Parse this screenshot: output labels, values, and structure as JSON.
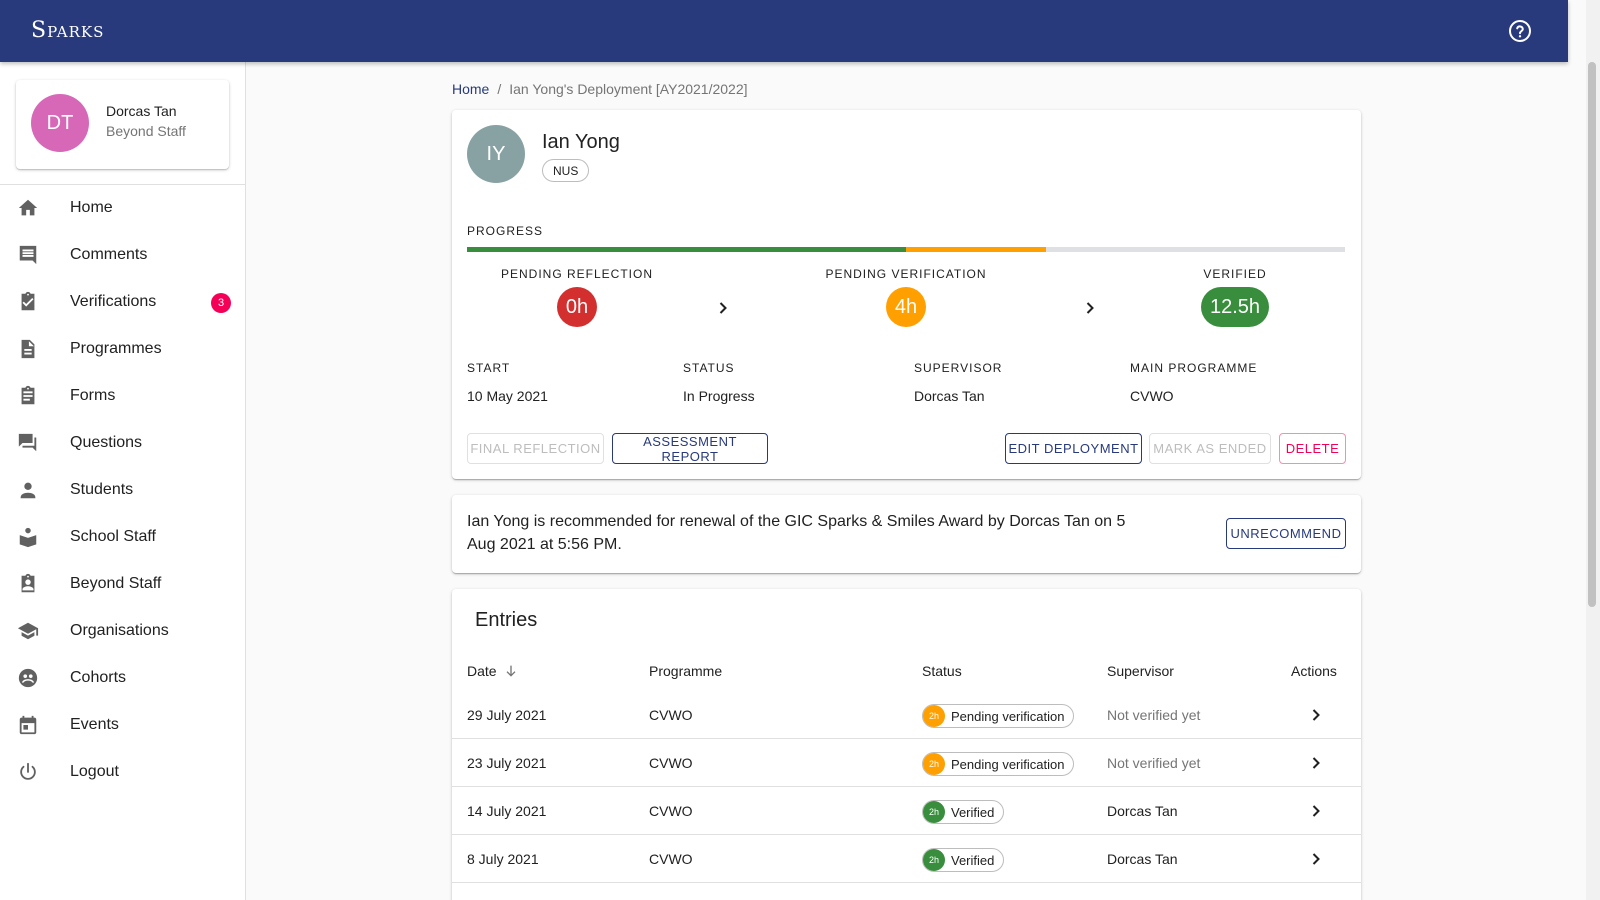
{
  "app": {
    "brand": "Sparks"
  },
  "user": {
    "initials": "DT",
    "name": "Dorcas Tan",
    "role": "Beyond Staff",
    "avatar_color": "#d768b8"
  },
  "nav": [
    {
      "label": "Home",
      "icon": "home-icon"
    },
    {
      "label": "Comments",
      "icon": "comment-icon"
    },
    {
      "label": "Verifications",
      "icon": "assignment-check-icon",
      "badge": "3"
    },
    {
      "label": "Programmes",
      "icon": "document-icon"
    },
    {
      "label": "Forms",
      "icon": "clipboard-icon"
    },
    {
      "label": "Questions",
      "icon": "forum-icon"
    },
    {
      "label": "Students",
      "icon": "person-icon"
    },
    {
      "label": "School Staff",
      "icon": "teacher-icon"
    },
    {
      "label": "Beyond Staff",
      "icon": "badge-icon"
    },
    {
      "label": "Organisations",
      "icon": "school-icon"
    },
    {
      "label": "Cohorts",
      "icon": "group-icon"
    },
    {
      "label": "Events",
      "icon": "calendar-icon"
    },
    {
      "label": "Logout",
      "icon": "power-icon"
    }
  ],
  "breadcrumb": {
    "home": "Home",
    "sep": "/",
    "current": "Ian Yong's Deployment [AY2021/2022]"
  },
  "deployment": {
    "student_initials": "IY",
    "student_name": "Ian Yong",
    "school": "NUS",
    "progress_label": "Progress",
    "progress": {
      "verified_fraction": 0.5,
      "pending_fraction": 0.16
    },
    "stages": [
      {
        "label": "Pending Reflection",
        "hours": "0h",
        "color": "#d32f2f"
      },
      {
        "label": "Pending Verification",
        "hours": "4h",
        "color": "#ff9f00"
      },
      {
        "label": "Verified",
        "hours": "12.5h",
        "color": "#388e3c"
      }
    ],
    "info": [
      {
        "label": "Start",
        "value": "10 May 2021"
      },
      {
        "label": "Status",
        "value": "In Progress"
      },
      {
        "label": "Supervisor",
        "value": "Dorcas Tan"
      },
      {
        "label": "Main Programme",
        "value": "CVWO"
      }
    ],
    "buttons": {
      "final_reflection": "Final Reflection",
      "assessment_report": "Assessment Report",
      "edit": "Edit Deployment",
      "mark_ended": "Mark as ended",
      "delete": "Delete"
    }
  },
  "recommendation": {
    "text": "Ian Yong is recommended for renewal of the GIC Sparks & Smiles Award by Dorcas Tan on 5 Aug 2021 at 5:56 PM.",
    "button": "Unrecommend"
  },
  "entries": {
    "title": "Entries",
    "columns": {
      "date": "Date",
      "programme": "Programme",
      "status": "Status",
      "supervisor": "Supervisor",
      "actions": "Actions"
    },
    "rows": [
      {
        "date": "29 July 2021",
        "programme": "CVWO",
        "hours": "2h",
        "status": "Pending verification",
        "status_color": "#ff9f00",
        "supervisor": "Not verified yet",
        "muted": true
      },
      {
        "date": "23 July 2021",
        "programme": "CVWO",
        "hours": "2h",
        "status": "Pending verification",
        "status_color": "#ff9f00",
        "supervisor": "Not verified yet",
        "muted": true
      },
      {
        "date": "14 July 2021",
        "programme": "CVWO",
        "hours": "2h",
        "status": "Verified",
        "status_color": "#388e3c",
        "supervisor": "Dorcas Tan",
        "muted": false
      },
      {
        "date": "8 July 2021",
        "programme": "CVWO",
        "hours": "2h",
        "status": "Verified",
        "status_color": "#388e3c",
        "supervisor": "Dorcas Tan",
        "muted": false
      }
    ]
  },
  "colors": {
    "primary": "#283a7c",
    "verified": "#388e3c",
    "pending": "#ff9f00",
    "danger": "#f50057"
  }
}
